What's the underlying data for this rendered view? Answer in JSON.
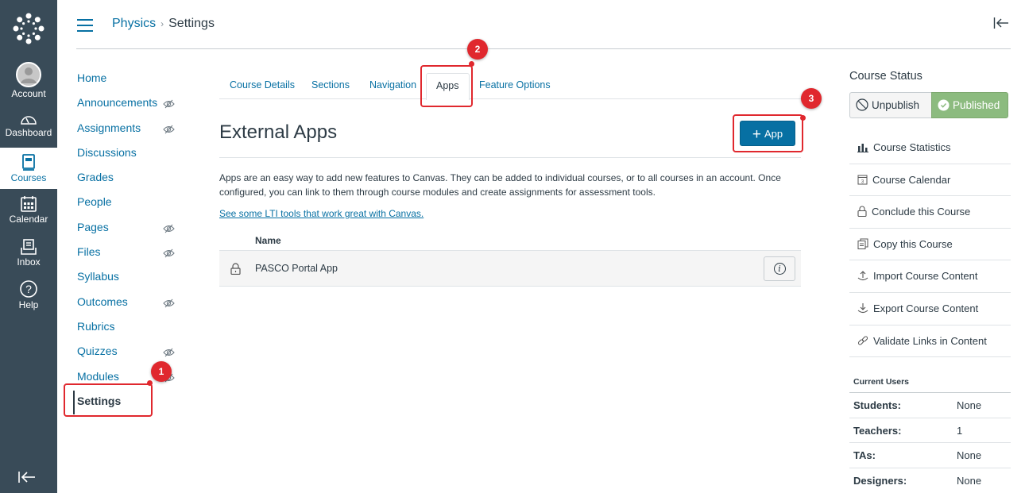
{
  "global_nav": {
    "items": [
      {
        "label": "Account",
        "icon": "avatar-icon"
      },
      {
        "label": "Dashboard",
        "icon": "dashboard-icon"
      },
      {
        "label": "Courses",
        "icon": "courses-icon",
        "active": true
      },
      {
        "label": "Calendar",
        "icon": "calendar-icon"
      },
      {
        "label": "Inbox",
        "icon": "inbox-icon"
      },
      {
        "label": "Help",
        "icon": "help-icon"
      }
    ]
  },
  "header": {
    "breadcrumb": {
      "course": "Physics",
      "current": "Settings"
    }
  },
  "course_nav": {
    "items": [
      {
        "label": "Home",
        "hidden": false
      },
      {
        "label": "Announcements",
        "hidden": true
      },
      {
        "label": "Assignments",
        "hidden": true
      },
      {
        "label": "Discussions",
        "hidden": false
      },
      {
        "label": "Grades",
        "hidden": false
      },
      {
        "label": "People",
        "hidden": false
      },
      {
        "label": "Pages",
        "hidden": true
      },
      {
        "label": "Files",
        "hidden": true
      },
      {
        "label": "Syllabus",
        "hidden": false
      },
      {
        "label": "Outcomes",
        "hidden": true
      },
      {
        "label": "Rubrics",
        "hidden": false
      },
      {
        "label": "Quizzes",
        "hidden": true
      },
      {
        "label": "Modules",
        "hidden": true
      },
      {
        "label": "Settings",
        "hidden": false,
        "active": true
      }
    ]
  },
  "annotations": {
    "step1": "1",
    "step2": "2",
    "step3": "3",
    "color": "#e0282e"
  },
  "tabs": [
    {
      "label": "Course Details"
    },
    {
      "label": "Sections"
    },
    {
      "label": "Navigation"
    },
    {
      "label": "Apps",
      "active": true
    },
    {
      "label": "Feature Options"
    }
  ],
  "main": {
    "title": "External Apps",
    "add_button": "App",
    "description": "Apps are an easy way to add new features to Canvas. They can be added to individual courses, or to all courses in an account. Once configured, you can link to them through course modules and create assignments for assessment tools.",
    "lti_link": "See some LTI tools that work great with Canvas.",
    "table": {
      "header_name": "Name",
      "rows": [
        {
          "name": "PASCO Portal App",
          "locked": true
        }
      ]
    }
  },
  "sidebar": {
    "status_title": "Course Status",
    "unpublish_label": "Unpublish",
    "published_label": "Published",
    "published_color": "#8cbb7f",
    "links": [
      {
        "label": "Course Statistics",
        "icon": "bar-chart-icon"
      },
      {
        "label": "Course Calendar",
        "icon": "calendar-icon"
      },
      {
        "label": "Conclude this Course",
        "icon": "lock-icon"
      },
      {
        "label": "Copy this Course",
        "icon": "copy-icon"
      },
      {
        "label": "Import Course Content",
        "icon": "upload-icon"
      },
      {
        "label": "Export Course Content",
        "icon": "download-icon"
      },
      {
        "label": "Validate Links in Content",
        "icon": "link-icon"
      }
    ],
    "current_users_title": "Current Users",
    "users": [
      {
        "role": "Students:",
        "count": "None"
      },
      {
        "role": "Teachers:",
        "count": "1"
      },
      {
        "role": "TAs:",
        "count": "None"
      },
      {
        "role": "Designers:",
        "count": "None"
      }
    ]
  }
}
